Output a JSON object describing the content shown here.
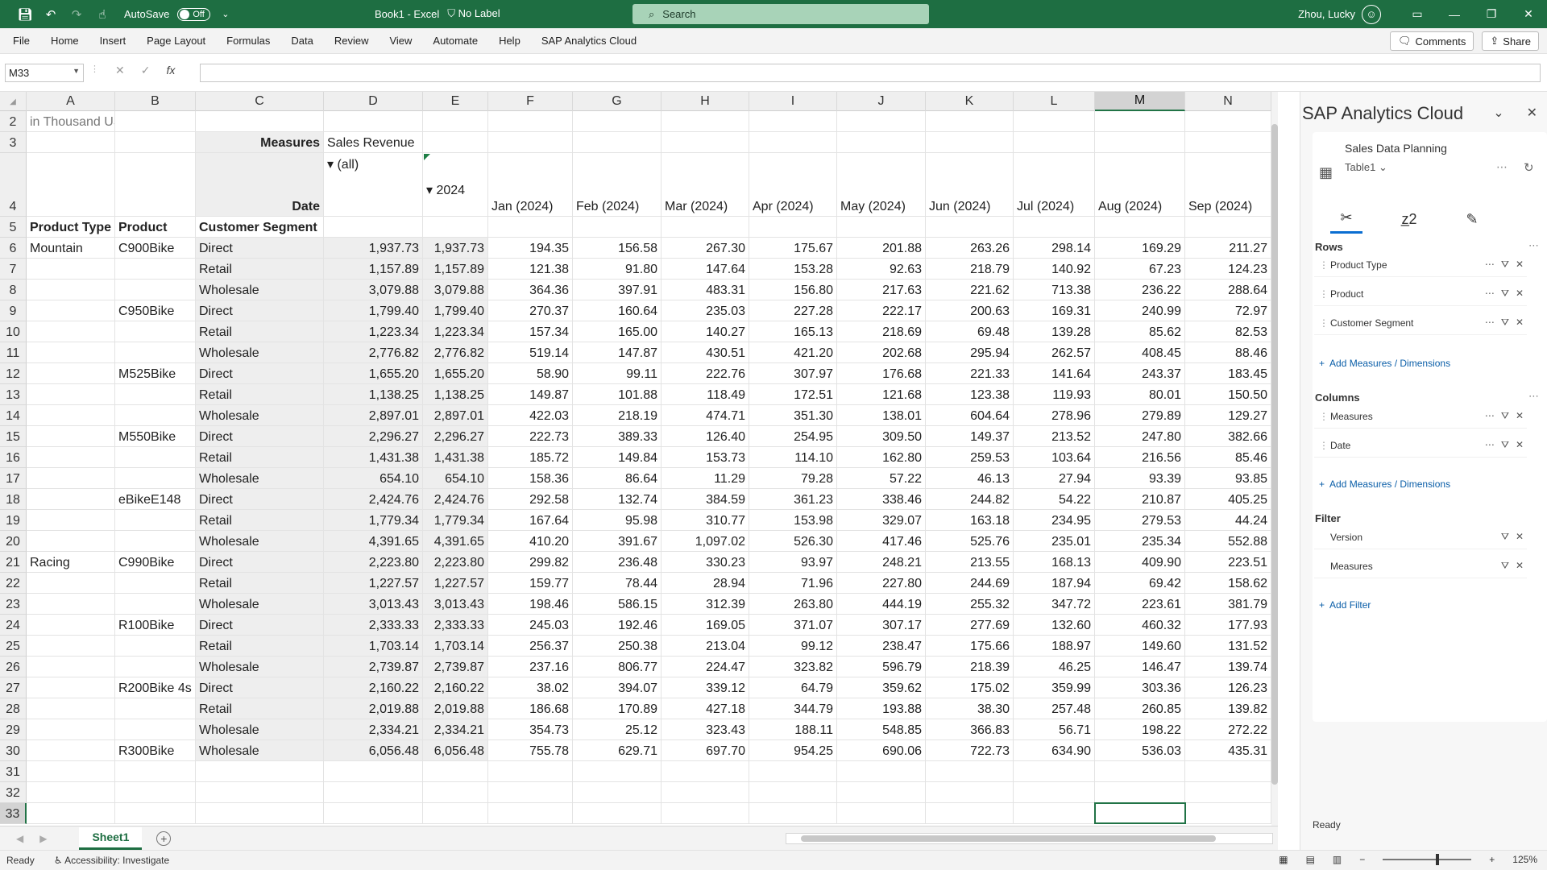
{
  "titlebar": {
    "autosave_label": "AutoSave",
    "autosave_state": "Off",
    "file_title": "Book1 - Excel",
    "sensitivity": "No Label",
    "search_placeholder": "Search",
    "user_name": "Zhou, Lucky"
  },
  "menu": {
    "items": [
      "File",
      "Home",
      "Insert",
      "Page Layout",
      "Formulas",
      "Data",
      "Review",
      "View",
      "Automate",
      "Help",
      "SAP Analytics Cloud"
    ],
    "comments_label": "Comments",
    "share_label": "Share"
  },
  "formula": {
    "name_box": "M33",
    "fx_label": "fx",
    "value": ""
  },
  "grid": {
    "columns": [
      "A",
      "B",
      "C",
      "D",
      "E",
      "F",
      "G",
      "H",
      "I",
      "J",
      "K",
      "L",
      "M",
      "N"
    ],
    "selected_column": "M",
    "selected_row": "33",
    "rows": [
      {
        "n": "2",
        "cells": {
          "A": "in Thousand USD"
        }
      },
      {
        "n": "3",
        "cells": {
          "C": "Measures",
          "D": "Sales Revenue"
        }
      },
      {
        "n": "4",
        "cells": {
          "C": "Date",
          "D": "▾ (all)",
          "E": "▾ 2024",
          "F": "Jan (2024)",
          "G": "Feb (2024)",
          "H": "Mar (2024)",
          "I": "Apr (2024)",
          "J": "May (2024)",
          "K": "Jun (2024)",
          "L": "Jul (2024)",
          "M": "Aug (2024)",
          "N": "Sep (2024)"
        }
      },
      {
        "n": "5",
        "cells": {
          "A": "Product Type",
          "B": "Product",
          "C": "Customer Segment"
        }
      },
      {
        "n": "6",
        "cells": {
          "A": "Mountain",
          "B": "C900Bike",
          "C": "Direct",
          "D": "1,937.73",
          "E": "1,937.73",
          "F": "194.35",
          "G": "156.58",
          "H": "267.30",
          "I": "175.67",
          "J": "201.88",
          "K": "263.26",
          "L": "298.14",
          "M": "169.29",
          "N": "211.27"
        }
      },
      {
        "n": "7",
        "cells": {
          "C": "Retail",
          "D": "1,157.89",
          "E": "1,157.89",
          "F": "121.38",
          "G": "91.80",
          "H": "147.64",
          "I": "153.28",
          "J": "92.63",
          "K": "218.79",
          "L": "140.92",
          "M": "67.23",
          "N": "124.23"
        }
      },
      {
        "n": "8",
        "cells": {
          "C": "Wholesale",
          "D": "3,079.88",
          "E": "3,079.88",
          "F": "364.36",
          "G": "397.91",
          "H": "483.31",
          "I": "156.80",
          "J": "217.63",
          "K": "221.62",
          "L": "713.38",
          "M": "236.22",
          "N": "288.64"
        }
      },
      {
        "n": "9",
        "cells": {
          "B": "C950Bike",
          "C": "Direct",
          "D": "1,799.40",
          "E": "1,799.40",
          "F": "270.37",
          "G": "160.64",
          "H": "235.03",
          "I": "227.28",
          "J": "222.17",
          "K": "200.63",
          "L": "169.31",
          "M": "240.99",
          "N": "72.97"
        }
      },
      {
        "n": "10",
        "cells": {
          "C": "Retail",
          "D": "1,223.34",
          "E": "1,223.34",
          "F": "157.34",
          "G": "165.00",
          "H": "140.27",
          "I": "165.13",
          "J": "218.69",
          "K": "69.48",
          "L": "139.28",
          "M": "85.62",
          "N": "82.53"
        }
      },
      {
        "n": "11",
        "cells": {
          "C": "Wholesale",
          "D": "2,776.82",
          "E": "2,776.82",
          "F": "519.14",
          "G": "147.87",
          "H": "430.51",
          "I": "421.20",
          "J": "202.68",
          "K": "295.94",
          "L": "262.57",
          "M": "408.45",
          "N": "88.46"
        }
      },
      {
        "n": "12",
        "cells": {
          "B": "M525Bike",
          "C": "Direct",
          "D": "1,655.20",
          "E": "1,655.20",
          "F": "58.90",
          "G": "99.11",
          "H": "222.76",
          "I": "307.97",
          "J": "176.68",
          "K": "221.33",
          "L": "141.64",
          "M": "243.37",
          "N": "183.45"
        }
      },
      {
        "n": "13",
        "cells": {
          "C": "Retail",
          "D": "1,138.25",
          "E": "1,138.25",
          "F": "149.87",
          "G": "101.88",
          "H": "118.49",
          "I": "172.51",
          "J": "121.68",
          "K": "123.38",
          "L": "119.93",
          "M": "80.01",
          "N": "150.50"
        }
      },
      {
        "n": "14",
        "cells": {
          "C": "Wholesale",
          "D": "2,897.01",
          "E": "2,897.01",
          "F": "422.03",
          "G": "218.19",
          "H": "474.71",
          "I": "351.30",
          "J": "138.01",
          "K": "604.64",
          "L": "278.96",
          "M": "279.89",
          "N": "129.27"
        }
      },
      {
        "n": "15",
        "cells": {
          "B": "M550Bike",
          "C": "Direct",
          "D": "2,296.27",
          "E": "2,296.27",
          "F": "222.73",
          "G": "389.33",
          "H": "126.40",
          "I": "254.95",
          "J": "309.50",
          "K": "149.37",
          "L": "213.52",
          "M": "247.80",
          "N": "382.66"
        }
      },
      {
        "n": "16",
        "cells": {
          "C": "Retail",
          "D": "1,431.38",
          "E": "1,431.38",
          "F": "185.72",
          "G": "149.84",
          "H": "153.73",
          "I": "114.10",
          "J": "162.80",
          "K": "259.53",
          "L": "103.64",
          "M": "216.56",
          "N": "85.46"
        }
      },
      {
        "n": "17",
        "cells": {
          "C": "Wholesale",
          "D": "654.10",
          "E": "654.10",
          "F": "158.36",
          "G": "86.64",
          "H": "11.29",
          "I": "79.28",
          "J": "57.22",
          "K": "46.13",
          "L": "27.94",
          "M": "93.39",
          "N": "93.85"
        }
      },
      {
        "n": "18",
        "cells": {
          "B": "eBikeE148",
          "C": "Direct",
          "D": "2,424.76",
          "E": "2,424.76",
          "F": "292.58",
          "G": "132.74",
          "H": "384.59",
          "I": "361.23",
          "J": "338.46",
          "K": "244.82",
          "L": "54.22",
          "M": "210.87",
          "N": "405.25"
        }
      },
      {
        "n": "19",
        "cells": {
          "C": "Retail",
          "D": "1,779.34",
          "E": "1,779.34",
          "F": "167.64",
          "G": "95.98",
          "H": "310.77",
          "I": "153.98",
          "J": "329.07",
          "K": "163.18",
          "L": "234.95",
          "M": "279.53",
          "N": "44.24"
        }
      },
      {
        "n": "20",
        "cells": {
          "C": "Wholesale",
          "D": "4,391.65",
          "E": "4,391.65",
          "F": "410.20",
          "G": "391.67",
          "H": "1,097.02",
          "I": "526.30",
          "J": "417.46",
          "K": "525.76",
          "L": "235.01",
          "M": "235.34",
          "N": "552.88"
        }
      },
      {
        "n": "21",
        "cells": {
          "A": "Racing",
          "B": "C990Bike",
          "C": "Direct",
          "D": "2,223.80",
          "E": "2,223.80",
          "F": "299.82",
          "G": "236.48",
          "H": "330.23",
          "I": "93.97",
          "J": "248.21",
          "K": "213.55",
          "L": "168.13",
          "M": "409.90",
          "N": "223.51"
        }
      },
      {
        "n": "22",
        "cells": {
          "C": "Retail",
          "D": "1,227.57",
          "E": "1,227.57",
          "F": "159.77",
          "G": "78.44",
          "H": "28.94",
          "I": "71.96",
          "J": "227.80",
          "K": "244.69",
          "L": "187.94",
          "M": "69.42",
          "N": "158.62"
        }
      },
      {
        "n": "23",
        "cells": {
          "C": "Wholesale",
          "D": "3,013.43",
          "E": "3,013.43",
          "F": "198.46",
          "G": "586.15",
          "H": "312.39",
          "I": "263.80",
          "J": "444.19",
          "K": "255.32",
          "L": "347.72",
          "M": "223.61",
          "N": "381.79"
        }
      },
      {
        "n": "24",
        "cells": {
          "B": "R100Bike",
          "C": "Direct",
          "D": "2,333.33",
          "E": "2,333.33",
          "F": "245.03",
          "G": "192.46",
          "H": "169.05",
          "I": "371.07",
          "J": "307.17",
          "K": "277.69",
          "L": "132.60",
          "M": "460.32",
          "N": "177.93"
        }
      },
      {
        "n": "25",
        "cells": {
          "C": "Retail",
          "D": "1,703.14",
          "E": "1,703.14",
          "F": "256.37",
          "G": "250.38",
          "H": "213.04",
          "I": "99.12",
          "J": "238.47",
          "K": "175.66",
          "L": "188.97",
          "M": "149.60",
          "N": "131.52"
        }
      },
      {
        "n": "26",
        "cells": {
          "C": "Wholesale",
          "D": "2,739.87",
          "E": "2,739.87",
          "F": "237.16",
          "G": "806.77",
          "H": "224.47",
          "I": "323.82",
          "J": "596.79",
          "K": "218.39",
          "L": "46.25",
          "M": "146.47",
          "N": "139.74"
        }
      },
      {
        "n": "27",
        "cells": {
          "B": "R200Bike 4s",
          "C": "Direct",
          "D": "2,160.22",
          "E": "2,160.22",
          "F": "38.02",
          "G": "394.07",
          "H": "339.12",
          "I": "64.79",
          "J": "359.62",
          "K": "175.02",
          "L": "359.99",
          "M": "303.36",
          "N": "126.23"
        }
      },
      {
        "n": "28",
        "cells": {
          "C": "Retail",
          "D": "2,019.88",
          "E": "2,019.88",
          "F": "186.68",
          "G": "170.89",
          "H": "427.18",
          "I": "344.79",
          "J": "193.88",
          "K": "38.30",
          "L": "257.48",
          "M": "260.85",
          "N": "139.82"
        }
      },
      {
        "n": "29",
        "cells": {
          "C": "Wholesale",
          "D": "2,334.21",
          "E": "2,334.21",
          "F": "354.73",
          "G": "25.12",
          "H": "323.43",
          "I": "188.11",
          "J": "548.85",
          "K": "366.83",
          "L": "56.71",
          "M": "198.22",
          "N": "272.22"
        }
      },
      {
        "n": "30",
        "cells": {
          "B": "R300Bike",
          "C": "Wholesale",
          "D": "6,056.48",
          "E": "6,056.48",
          "F": "755.78",
          "G": "629.71",
          "H": "697.70",
          "I": "954.25",
          "J": "690.06",
          "K": "722.73",
          "L": "634.90",
          "M": "536.03",
          "N": "435.31"
        }
      },
      {
        "n": "31",
        "cells": {}
      },
      {
        "n": "32",
        "cells": {}
      },
      {
        "n": "33",
        "cells": {}
      }
    ]
  },
  "sheets": {
    "tabs": [
      "Sheet1"
    ]
  },
  "status": {
    "ready": "Ready",
    "accessibility": "Accessibility: Investigate",
    "zoom": "125%"
  },
  "panel": {
    "title": "SAP Analytics Cloud",
    "model_title": "Sales Data Planning",
    "table_name": "Table1",
    "rows_label": "Rows",
    "rows": [
      "Product Type",
      "Product",
      "Customer Segment"
    ],
    "columns_label": "Columns",
    "columns": [
      "Measures",
      "Date"
    ],
    "add_dimensions_label": "Add Measures / Dimensions",
    "filter_label": "Filter",
    "filters": [
      "Version",
      "Measures"
    ],
    "add_filter_label": "Add Filter",
    "status": "Ready"
  }
}
